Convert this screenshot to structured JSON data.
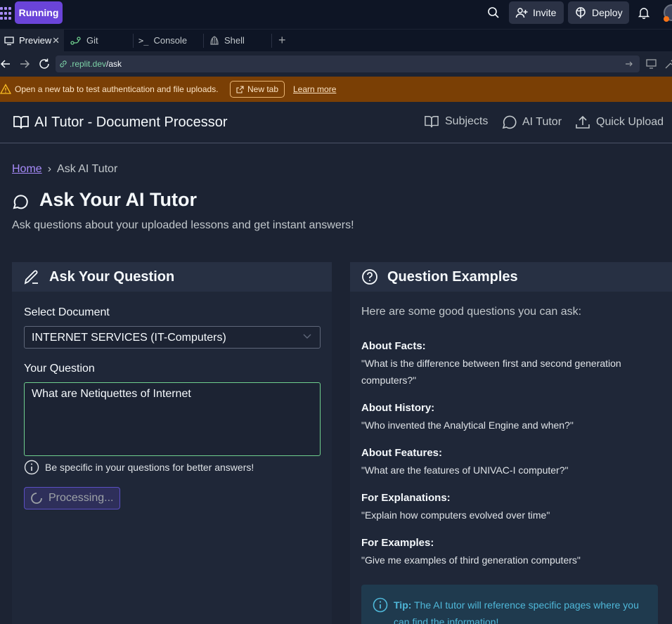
{
  "topbar": {
    "run_label": "Running",
    "invite_label": "Invite",
    "deploy_label": "Deploy"
  },
  "tabs": [
    {
      "label": "Preview",
      "icon": "monitor-icon"
    },
    {
      "label": "Git",
      "icon": "git-icon"
    },
    {
      "label": "Console",
      "icon": "console-icon"
    },
    {
      "label": "Shell",
      "icon": "shell-icon"
    }
  ],
  "address": {
    "domain": ".replit.dev",
    "path": "/ask"
  },
  "banner": {
    "text": "Open a new tab to test authentication and file uploads.",
    "new_tab_label": "New tab",
    "learn_more_label": "Learn more"
  },
  "app": {
    "title": "AI Tutor - Document Processor",
    "nav": [
      {
        "label": "Subjects",
        "icon": "book-icon"
      },
      {
        "label": "AI Tutor",
        "icon": "chat-icon"
      },
      {
        "label": "Quick Upload",
        "icon": "upload-icon"
      }
    ]
  },
  "breadcrumb": {
    "home": "Home",
    "separator": "›",
    "current": "Ask AI Tutor"
  },
  "page": {
    "title": "Ask Your AI Tutor",
    "subtitle": "Ask questions about your uploaded lessons and get instant answers!"
  },
  "ask_card": {
    "title": "Ask Your Question",
    "select_label": "Select Document",
    "select_value": "INTERNET SERVICES (IT-Computers)",
    "question_label": "Your Question",
    "question_value": "What are Netiquettes of Internet",
    "hint": "Be specific in your questions for better answers!",
    "button_label": "Processing..."
  },
  "examples_card": {
    "title": "Question Examples",
    "intro": "Here are some good questions you can ask:",
    "items": [
      {
        "heading": "About Facts:",
        "question": "\"What is the difference between first and second generation computers?\""
      },
      {
        "heading": "About History:",
        "question": "\"Who invented the Analytical Engine and when?\""
      },
      {
        "heading": "About Features:",
        "question": "\"What are the features of UNIVAC-I computer?\""
      },
      {
        "heading": "For Explanations:",
        "question": "\"Explain how computers evolved over time\""
      },
      {
        "heading": "For Examples:",
        "question": "\"Give me examples of third generation computers\""
      }
    ],
    "tip_label": "Tip:",
    "tip_text": "The AI tutor will reference specific pages where you can find the information!"
  },
  "colors": {
    "accent": "#6a44d9",
    "background": "#1c2333",
    "banner": "#7a3f05",
    "focus_border": "#6fcf8e",
    "tip_text": "#4fb8d9"
  }
}
